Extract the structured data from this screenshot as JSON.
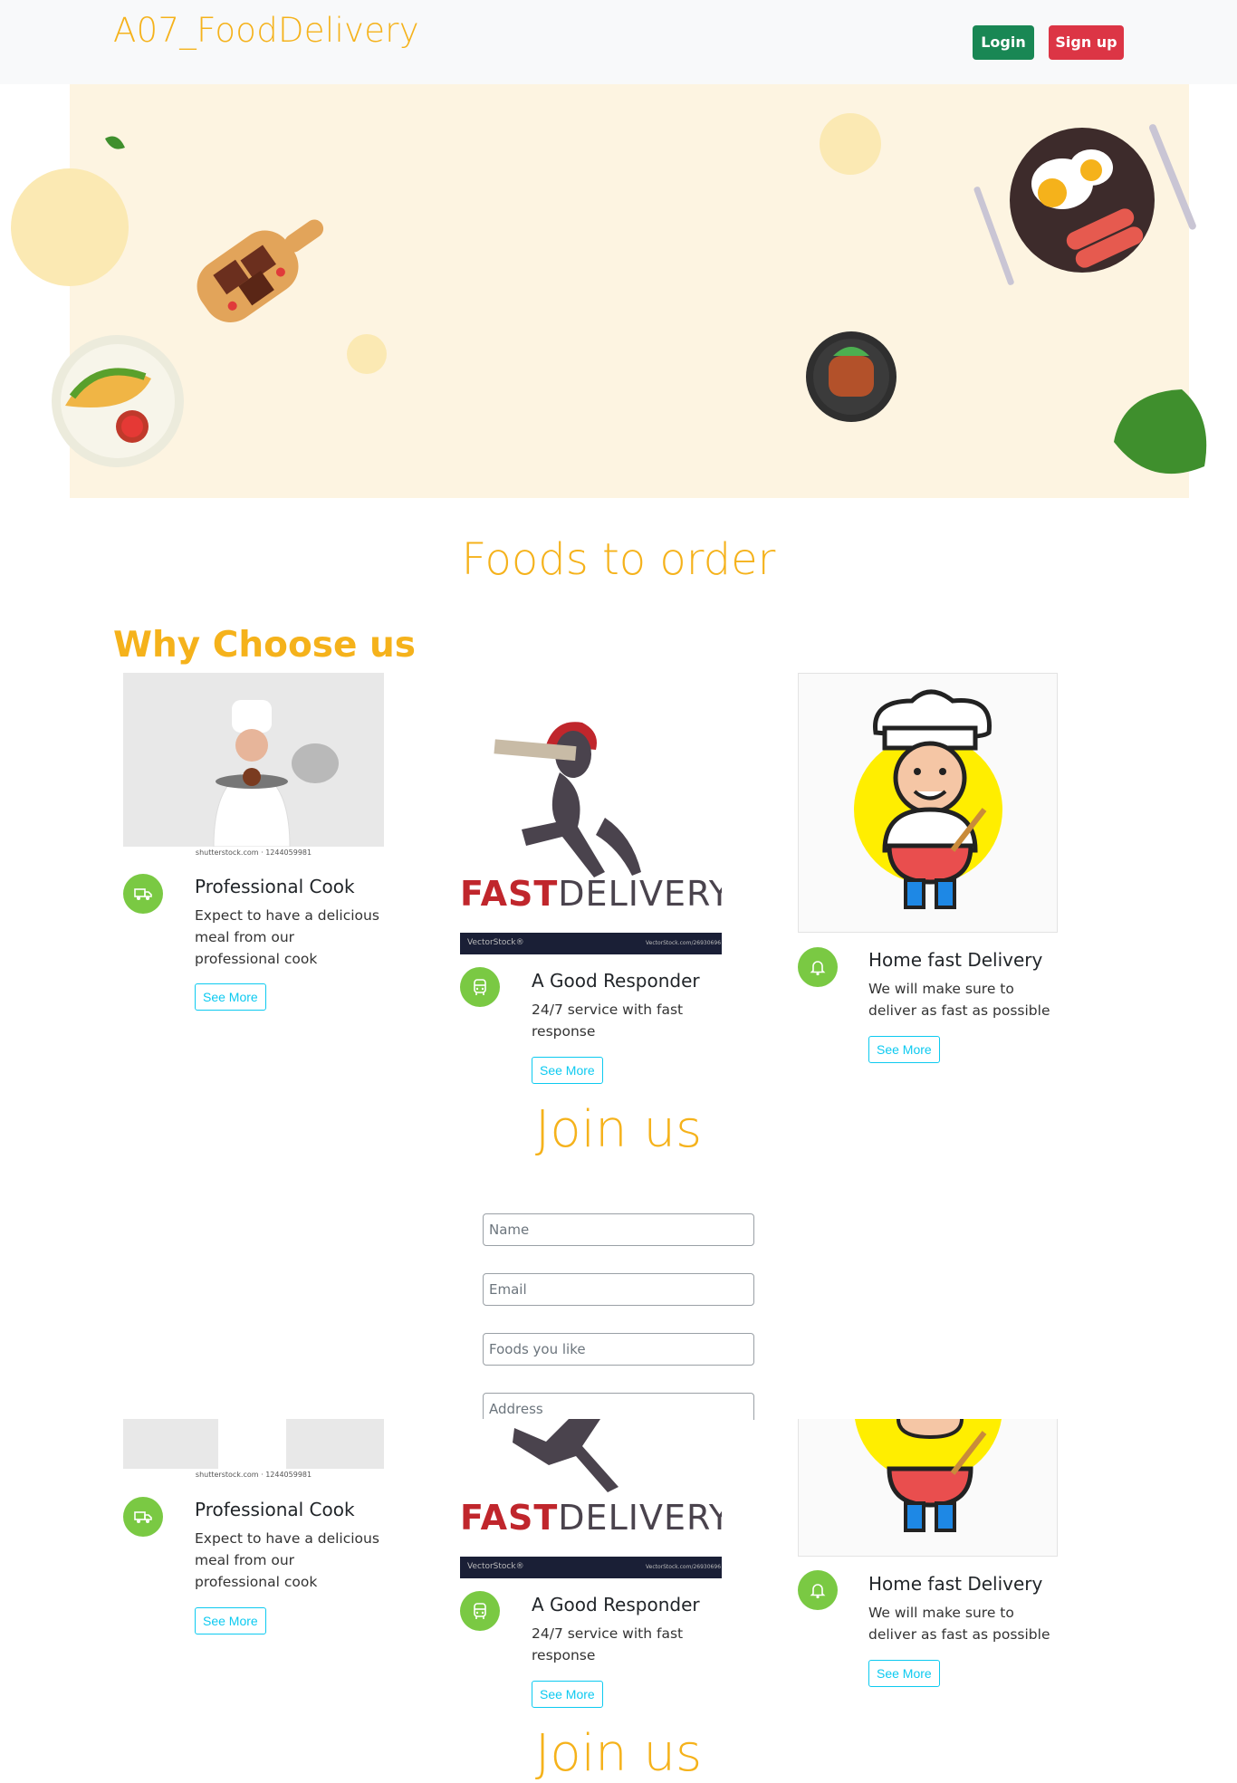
{
  "navbar": {
    "brand": "A07_FoodDelivery",
    "login_label": "Login",
    "signup_label": "Sign up"
  },
  "sections": {
    "foods_title": "Foods to order",
    "why_title": "Why Choose us",
    "join_title": "Join us"
  },
  "features": [
    {
      "title": "Professional Cook",
      "text": "Expect to have a delicious meal from our professional cook",
      "button": "See More",
      "icon": "truck-icon",
      "image_caption": "shutterstock.com · 1244059981"
    },
    {
      "title": "A Good Responder",
      "text": "24/7 service with fast response",
      "button": "See More",
      "icon": "bus-icon",
      "image_brand_a": "FAST",
      "image_brand_b": "DELIVERY",
      "image_footer_left": "VectorStock®",
      "image_footer_right": "VectorStock.com/26930696"
    },
    {
      "title": "Home fast Delivery",
      "text": "We will make sure to deliver as fast as possible",
      "button": "See More",
      "icon": "bell-icon"
    }
  ],
  "form": {
    "name_placeholder": "Name",
    "email_placeholder": "Email",
    "foods_placeholder": "Foods you like",
    "address_placeholder": "Address"
  },
  "colors": {
    "accent": "#f5b21b",
    "hero_bg": "#fdf4e1",
    "login": "#198754",
    "signup": "#dc3545",
    "icon_bg": "#7ac943",
    "outline": "#0dcaf0"
  }
}
